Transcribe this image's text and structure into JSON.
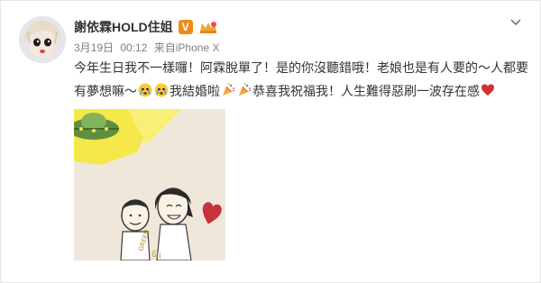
{
  "post": {
    "author": {
      "name": "謝依霖HOLD住姐",
      "badge_letter": "V"
    },
    "meta": {
      "date": "3月19日",
      "time": "00:12",
      "source_prefix": "来自",
      "device": "iPhone X"
    },
    "text": {
      "segment_1": "今年生日我不一樣囉！阿霖脫單了！是的你沒聽錯哦！老娘也是有人要的～人都要有夢想嘛～",
      "segment_2": "我結婚啦",
      "segment_3": "恭喜我祝福我！人生難得惡刷一波存在感"
    },
    "emojis": [
      "crying-face-emoji",
      "crying-face-emoji",
      "party-popper-emoji",
      "party-popper-emoji",
      "red-heart-emoji"
    ],
    "photo": {
      "drawn_text": "GREEN & I"
    }
  },
  "colors": {
    "username": "#333333",
    "meta": "#808080",
    "badge": "#f08b17",
    "heart": "#d32f2f"
  },
  "icons": {
    "menu": "chevron-down-icon"
  }
}
